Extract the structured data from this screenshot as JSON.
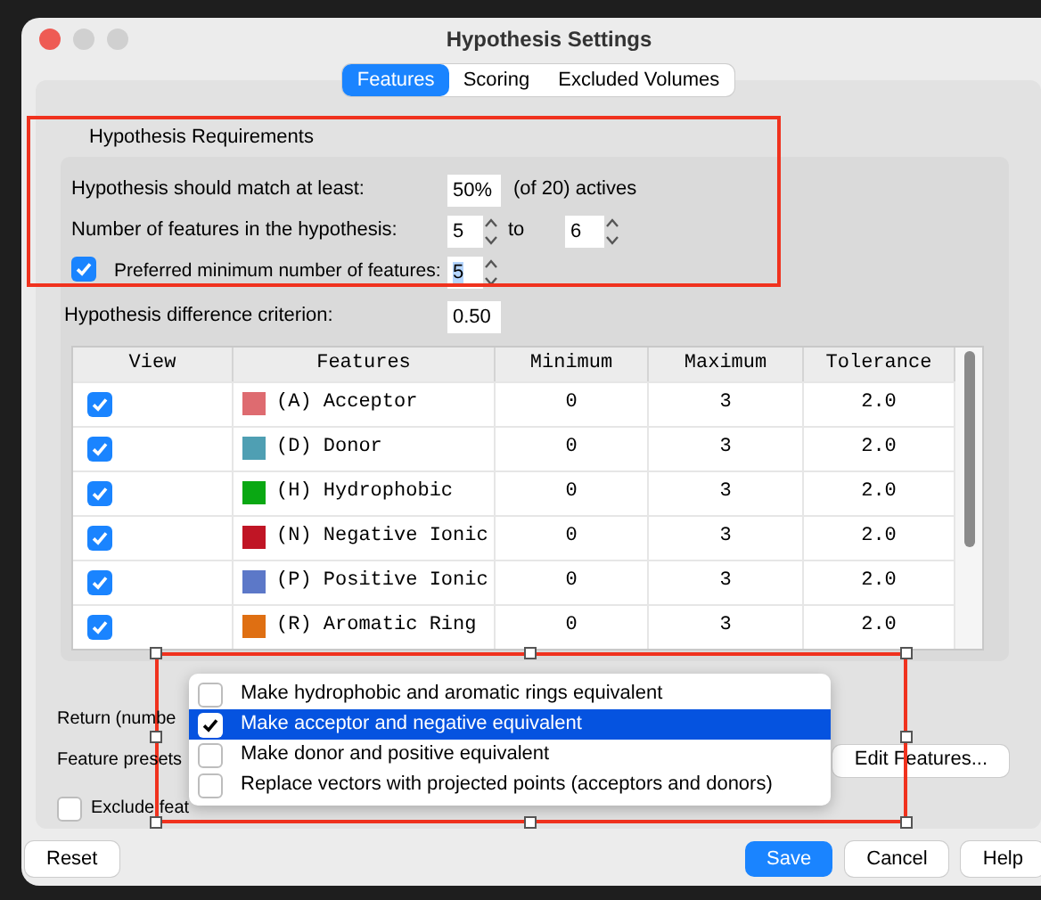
{
  "window": {
    "title": "Hypothesis Settings"
  },
  "tabs": [
    {
      "label": "Features",
      "selected": true
    },
    {
      "label": "Scoring",
      "selected": false
    },
    {
      "label": "Excluded Volumes",
      "selected": false
    }
  ],
  "requirements": {
    "title": "Hypothesis Requirements",
    "match": {
      "label": "Hypothesis should match at least:",
      "value": "50%",
      "suffix": "(of 20) actives"
    },
    "count": {
      "label": "Number of features in the hypothesis:",
      "min": "5",
      "to": "to",
      "max": "6"
    },
    "preferred": {
      "checked": true,
      "label": "Preferred minimum number of features:",
      "value": "5"
    }
  },
  "difference": {
    "label": "Hypothesis difference criterion:",
    "value": "0.50"
  },
  "table": {
    "columns": [
      "View",
      "Features",
      "Minimum",
      "Maximum",
      "Tolerance"
    ],
    "rows": [
      {
        "view": true,
        "color": "#de6b70",
        "feature": "(A) Acceptor",
        "minimum": "0",
        "maximum": "3",
        "tolerance": "2.0"
      },
      {
        "view": true,
        "color": "#4f9fb3",
        "feature": "(D) Donor",
        "minimum": "0",
        "maximum": "3",
        "tolerance": "2.0"
      },
      {
        "view": true,
        "color": "#0aa813",
        "feature": "(H) Hydrophobic",
        "minimum": "0",
        "maximum": "3",
        "tolerance": "2.0"
      },
      {
        "view": true,
        "color": "#c01525",
        "feature": "(N) Negative Ionic",
        "minimum": "0",
        "maximum": "3",
        "tolerance": "2.0"
      },
      {
        "view": true,
        "color": "#5c78c8",
        "feature": "(P) Positive Ionic",
        "minimum": "0",
        "maximum": "3",
        "tolerance": "2.0"
      },
      {
        "view": true,
        "color": "#df6f12",
        "feature": "(R) Aromatic Ring",
        "minimum": "0",
        "maximum": "3",
        "tolerance": "2.0"
      }
    ]
  },
  "return_label": "Return (numbe",
  "presets": {
    "label": "Feature presets",
    "button": "Edit Features..."
  },
  "exclude": {
    "checked": false,
    "label": "Exclude feat"
  },
  "menu": {
    "items": [
      {
        "label": "Make hydrophobic and aromatic rings equivalent",
        "checked": false,
        "selected": false
      },
      {
        "label": "Make acceptor and negative equivalent",
        "checked": true,
        "selected": true
      },
      {
        "label": "Make donor and positive equivalent",
        "checked": false,
        "selected": false
      },
      {
        "label": "Replace vectors with projected points (acceptors and donors)",
        "checked": false,
        "selected": false
      }
    ]
  },
  "buttons": [
    {
      "kind": "plain",
      "label": "Reset"
    },
    {
      "kind": "primary",
      "label": "Save"
    },
    {
      "kind": "plain",
      "label": "Cancel"
    },
    {
      "kind": "plain",
      "label": "Help"
    }
  ]
}
